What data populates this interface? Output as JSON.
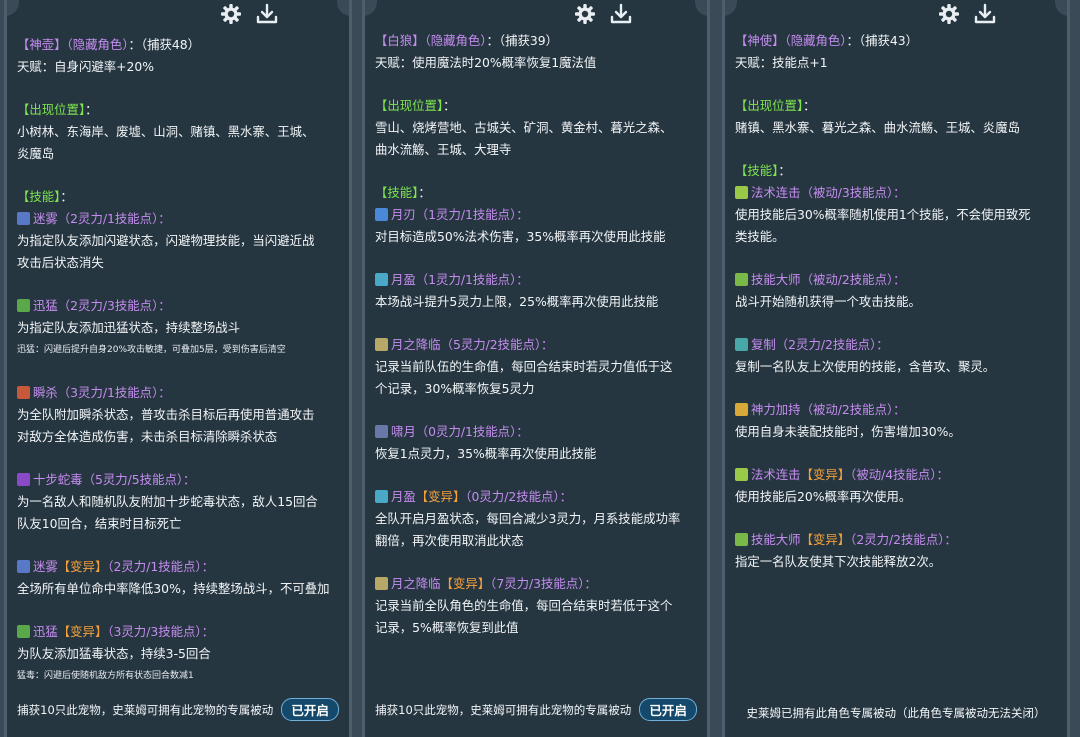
{
  "colors": {
    "role": "#c58cf0",
    "section": "#7de34f",
    "skill": "#c58cf0",
    "mutation": "#f2a03a",
    "text": "#f2f5f7",
    "panel_bg": "#263641"
  },
  "panels": [
    {
      "toolbar": {
        "settings_icon": "gear-icon",
        "download_icon": "download-icon"
      },
      "header": {
        "name": "【神壶】",
        "tag": "（隐藏角色）",
        "capture": "：（捕获48）"
      },
      "talent": "天赋：自身闪避率+20%",
      "location_title": "【出现位置】",
      "location_suffix": "：",
      "location_text_1": "小树林、东海岸、废墟、山洞、赌镇、黑水寨、王城、",
      "location_text_2": "炎魔岛",
      "skills_title": "【技能】",
      "skills_suffix": "：",
      "skills": [
        {
          "name": "迷雾",
          "cost": "（2灵力/1技能点）：",
          "desc_1": "为指定队友添加闪避状态，闪避物理技能，当闪避近战",
          "desc_2": "攻击后状态消失",
          "icon_color": "#5a78c8"
        },
        {
          "name": "迅猛",
          "cost": "（2灵力/3技能点）：",
          "desc_1": "为指定队友添加迅猛状态，持续整场战斗",
          "note": "迅猛：闪避后提升自身20%攻击敏捷，可叠加5层，受到伤害后清空",
          "icon_color": "#5aa84a"
        },
        {
          "name": "瞬杀",
          "cost": "（3灵力/1技能点）：",
          "desc_1": "为全队附加瞬杀状态，普攻击杀目标后再使用普通攻击",
          "desc_2": "对敌方全体造成伤害，未击杀目标清除瞬杀状态",
          "icon_color": "#c8583a"
        },
        {
          "name": "十步蛇毒",
          "cost": "（5灵力/5技能点）：",
          "desc_1": "为一名敌人和随机队友附加十步蛇毒状态，敌人15回合",
          "desc_2": "队友10回合，结束时目标死亡",
          "icon_color": "#8a4ac8"
        },
        {
          "name": "迷雾",
          "mutation": "【变异】",
          "cost": "（2灵力/1技能点）：",
          "desc_1": "全场所有单位命中率降低30%，持续整场战斗，不可叠加",
          "icon_color": "#5a78c8"
        },
        {
          "name": "迅猛",
          "mutation": "【变异】",
          "cost": "（3灵力/3技能点）：",
          "desc_1": "为队友添加猛毒状态，持续3-5回合",
          "note": "猛毒：闪避后使随机敌方所有状态回合数减1",
          "icon_color": "#5aa84a"
        }
      ],
      "footer": {
        "text": "捕获10只此宠物，史莱姆可拥有此宠物的专属被动",
        "button": "已开启"
      }
    },
    {
      "toolbar": {
        "settings_icon": "gear-icon",
        "download_icon": "download-icon"
      },
      "header": {
        "name": "【白狼】",
        "tag": "（隐藏角色）",
        "capture": "：（捕获39）"
      },
      "talent": "天赋：使用魔法时20%概率恢复1魔法值",
      "location_title": "【出现位置】",
      "location_suffix": "：",
      "location_text_1": "雪山、烧烤营地、古城关、矿洞、黄金村、暮光之森、",
      "location_text_2": "曲水流觞、王城、大理寺",
      "skills_title": "【技能】",
      "skills_suffix": "：",
      "skills": [
        {
          "name": "月刃",
          "cost": "（1灵力/1技能点）：",
          "desc_1": "对目标造成50%法术伤害，35%概率再次使用此技能",
          "icon_color": "#4a88d8"
        },
        {
          "name": "月盈",
          "cost": "（1灵力/1技能点）：",
          "desc_1": "本场战斗提升5灵力上限，25%概率再次使用此技能",
          "icon_color": "#4aa8c8"
        },
        {
          "name": "月之降临",
          "cost": "（5灵力/2技能点）：",
          "desc_1": "记录当前队伍的生命值，每回合结束时若灵力值低于这",
          "desc_2": "个记录，30%概率恢复5灵力",
          "icon_color": "#b8a868"
        },
        {
          "name": "啸月",
          "cost": "（0灵力/1技能点）：",
          "desc_1": "恢复1点灵力，35%概率再次使用此技能",
          "icon_color": "#6878a8"
        },
        {
          "name": "月盈",
          "mutation": "【变异】",
          "cost": "（0灵力/2技能点）：",
          "desc_1": "全队开启月盈状态，每回合减少3灵力，月系技能成功率",
          "desc_2": "翻倍，再次使用取消此状态",
          "icon_color": "#4aa8c8"
        },
        {
          "name": "月之降临",
          "mutation": "【变异】",
          "cost": "（7灵力/3技能点）：",
          "desc_1": "记录当前全队角色的生命值，每回合结束时若低于这个",
          "desc_2": "记录，5%概率恢复到此值",
          "icon_color": "#b8a868"
        }
      ],
      "footer": {
        "text": "捕获10只此宠物，史莱姆可拥有此宠物的专属被动",
        "button": "已开启"
      }
    },
    {
      "toolbar": {
        "settings_icon": "gear-icon",
        "download_icon": "download-icon"
      },
      "header": {
        "name": "【神使】",
        "tag": "（隐藏角色）",
        "capture": "：（捕获43）"
      },
      "talent": "天赋：技能点+1",
      "location_title": "【出现位置】",
      "location_suffix": "：",
      "location_text_1": "赌镇、黑水寨、暮光之森、曲水流觞、王城、炎魔岛",
      "skills_title": "【技能】",
      "skills_suffix": "：",
      "skills": [
        {
          "name": "法术连击",
          "cost": "（被动/3技能点）：",
          "desc_1": "使用技能后30%概率随机使用1个技能，不会使用致死",
          "desc_2": "类技能。",
          "icon_color": "#9ac848"
        },
        {
          "name": "技能大师",
          "cost": "（被动/2技能点）：",
          "desc_1": "战斗开始随机获得一个攻击技能。",
          "icon_color": "#7ab848"
        },
        {
          "name": "复制",
          "cost": "（2灵力/2技能点）：",
          "desc_1": "复制一名队友上次使用的技能，含普攻、聚灵。",
          "icon_color": "#48a8a8"
        },
        {
          "name": "神力加持",
          "cost": "（被动/2技能点）：",
          "desc_1": "使用自身未装配技能时，伤害增加30%。",
          "icon_color": "#d8a838"
        },
        {
          "name": "法术连击",
          "mutation": "【变异】",
          "cost": "（被动/4技能点）：",
          "desc_1": "使用技能后20%概率再次使用。",
          "icon_color": "#9ac848"
        },
        {
          "name": "技能大师",
          "mutation": "【变异】",
          "cost": "（2灵力/2技能点）：",
          "desc_1": "指定一名队友使其下次技能释放2次。",
          "icon_color": "#7ab848"
        }
      ],
      "footer": {
        "text": "史莱姆已拥有此角色专属被动（此角色专属被动无法关闭）"
      }
    }
  ]
}
